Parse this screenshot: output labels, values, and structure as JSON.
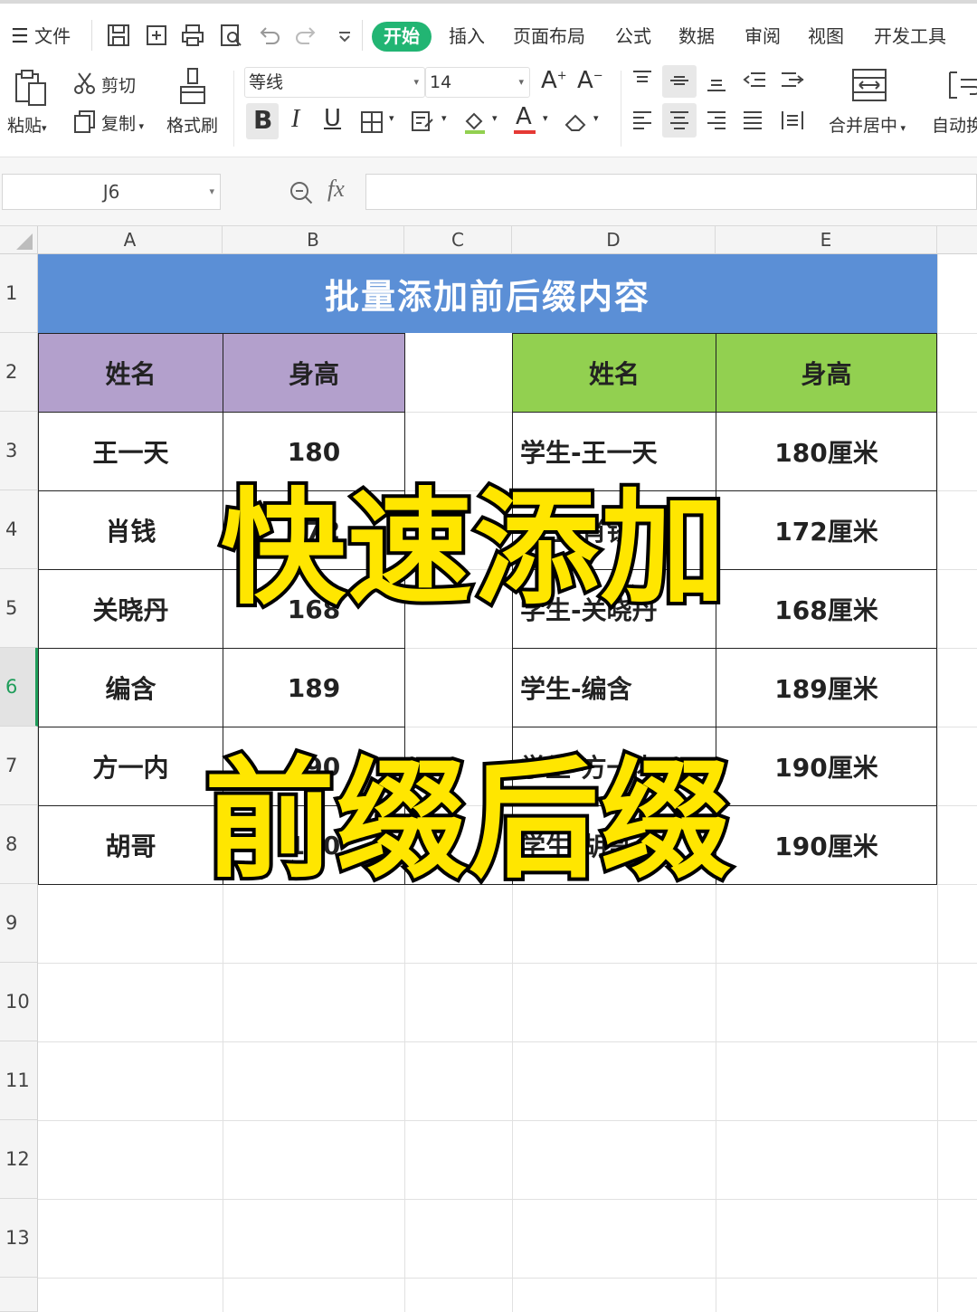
{
  "menubar": {
    "file_label": "文件",
    "tabs": [
      {
        "label": "开始",
        "active": true
      },
      {
        "label": "插入"
      },
      {
        "label": "页面布局"
      },
      {
        "label": "公式"
      },
      {
        "label": "数据"
      },
      {
        "label": "审阅"
      },
      {
        "label": "视图"
      },
      {
        "label": "开发工具"
      }
    ]
  },
  "ribbon": {
    "paste_label": "粘贴",
    "cut_label": "剪切",
    "copy_label": "复制",
    "format_painter_label": "格式刷",
    "font_name": "等线",
    "font_size": "14",
    "merge_center_label": "合并居中",
    "auto_wrap_label": "自动换"
  },
  "formula_bar": {
    "cell_ref": "J6",
    "fx_label": "fx",
    "formula": ""
  },
  "columns": [
    "A",
    "B",
    "C",
    "D",
    "E"
  ],
  "rows": [
    "1",
    "2",
    "3",
    "4",
    "5",
    "6",
    "7",
    "8",
    "9",
    "10",
    "11",
    "12",
    "13"
  ],
  "selected_row": "6",
  "sheet": {
    "title": "批量添加前后缀内容",
    "left_table": {
      "headers": [
        "姓名",
        "身高"
      ],
      "rows": [
        [
          "王一天",
          "180"
        ],
        [
          "肖钱",
          "172"
        ],
        [
          "关晓丹",
          "168"
        ],
        [
          "编含",
          "189"
        ],
        [
          "方一内",
          "190"
        ],
        [
          "胡哥",
          "190"
        ]
      ]
    },
    "right_table": {
      "headers": [
        "姓名",
        "身高"
      ],
      "rows": [
        [
          "学生-王一天",
          "180厘米"
        ],
        [
          "学生-肖钱",
          "172厘米"
        ],
        [
          "学生-关晓丹",
          "168厘米"
        ],
        [
          "学生-编含",
          "189厘米"
        ],
        [
          "学生-方一内",
          "190厘米"
        ],
        [
          "学生-胡哥",
          "190厘米"
        ]
      ]
    }
  },
  "overlay": {
    "line1": "快速添加",
    "line2": "前缀后缀"
  },
  "colors": {
    "title_bg": "#5b8fd6",
    "left_header_bg": "#b3a0cc",
    "right_header_bg": "#92d050",
    "start_tab_bg": "#22b573",
    "overlay_text": "#ffe600"
  }
}
